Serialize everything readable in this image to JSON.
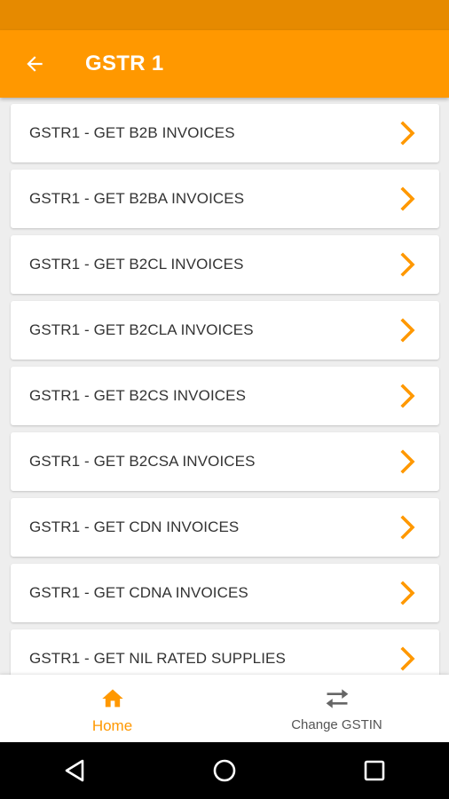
{
  "header": {
    "title": "GSTR 1"
  },
  "items": [
    {
      "label": "GSTR1 - GET B2B INVOICES"
    },
    {
      "label": "GSTR1 - GET B2BA INVOICES"
    },
    {
      "label": "GSTR1 - GET B2CL INVOICES"
    },
    {
      "label": "GSTR1 - GET B2CLA INVOICES"
    },
    {
      "label": "GSTR1 - GET B2CS INVOICES"
    },
    {
      "label": "GSTR1 - GET B2CSA INVOICES"
    },
    {
      "label": "GSTR1 - GET CDN INVOICES"
    },
    {
      "label": "GSTR1 - GET CDNA INVOICES"
    },
    {
      "label": "GSTR1 - GET NIL RATED SUPPLIES"
    }
  ],
  "bottom_nav": {
    "home_label": "Home",
    "change_gstin_label": "Change GSTIN"
  },
  "colors": {
    "accent": "#ff9800",
    "status_bar": "#e68a00",
    "background": "#eeeeee"
  },
  "icons": {
    "back": "arrow-left-icon",
    "chevron": "chevron-right-icon",
    "home": "home-icon",
    "change_gstin": "swap-arrows-icon"
  }
}
